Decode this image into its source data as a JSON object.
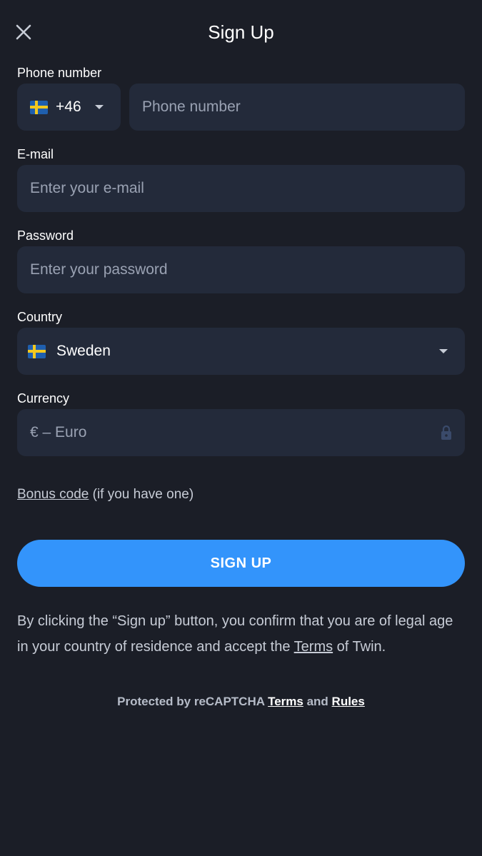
{
  "header": {
    "title": "Sign Up",
    "close_icon": "close-icon"
  },
  "phone": {
    "label": "Phone number",
    "country_code": "+46",
    "flag_icon": "sweden-flag-icon",
    "placeholder": "Phone number",
    "value": ""
  },
  "email": {
    "label": "E-mail",
    "placeholder": "Enter your e-mail",
    "value": ""
  },
  "password": {
    "label": "Password",
    "placeholder": "Enter your password",
    "value": ""
  },
  "country": {
    "label": "Country",
    "selected": "Sweden",
    "flag_icon": "sweden-flag-icon"
  },
  "currency": {
    "label": "Currency",
    "value": "€ – Euro",
    "lock_icon": "lock-icon"
  },
  "bonus": {
    "link": "Bonus code",
    "suffix": " (if you have one)"
  },
  "signup_button": "SIGN UP",
  "legal": {
    "prefix": "By clicking the “Sign up” button, you confirm that you are of legal age in your country of residence and accept the ",
    "terms_link": "Terms",
    "suffix": " of Twin."
  },
  "recaptcha": {
    "prefix": "Protected by reCAPTCHA ",
    "terms_link": "Terms",
    "and": " and ",
    "rules_link": "Rules"
  },
  "colors": {
    "background": "#1b1e27",
    "field": "#232a3a",
    "accent": "#3394fb",
    "muted_text": "#9aa2b3"
  }
}
